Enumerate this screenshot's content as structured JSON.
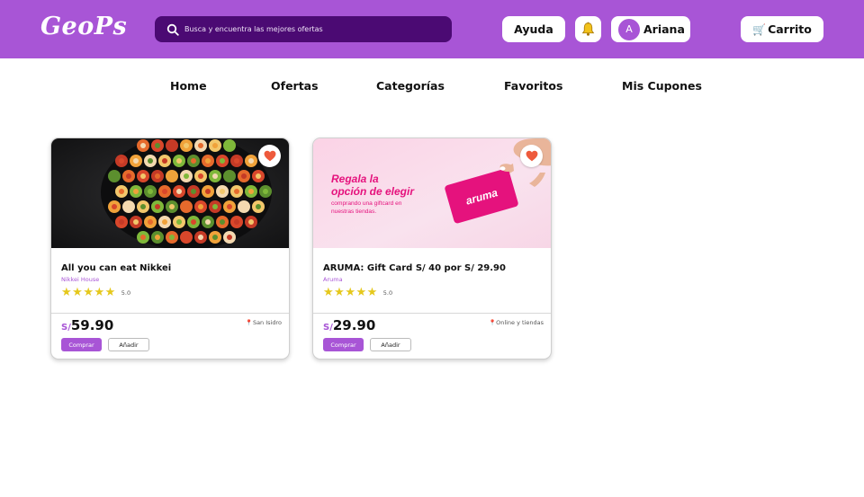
{
  "header": {
    "logo": "GeoPs",
    "search_placeholder": "Busca y encuentra las mejores ofertas",
    "help_label": "Ayuda",
    "user_initial": "A",
    "user_name": "Ariana",
    "cart_label": "Carrito"
  },
  "nav": {
    "items": [
      "Home",
      "Ofertas",
      "Categorías",
      "Favoritos",
      "Mis Cupones"
    ]
  },
  "products": [
    {
      "title": "All you can eat Nikkei",
      "store": "Nikkei House",
      "rating": "5.0",
      "stars": 5,
      "currency": "S/",
      "price": "59.90",
      "location": "San Isidro",
      "buy_label": "Comprar",
      "add_label": "Añadir"
    },
    {
      "title": "ARUMA: Gift Card S/ 40 por S/ 29.90",
      "store": "Aruma",
      "rating": "5.0",
      "stars": 5,
      "currency": "S/",
      "price": "29.90",
      "location": "Online y tiendas",
      "buy_label": "Comprar",
      "add_label": "Añadir",
      "banner": {
        "headline_1": "Regala la",
        "headline_2": "opción de elegir",
        "subtext_1": "comprando una giftcard en",
        "subtext_2": "nuestras tiendas.",
        "card_brand": "aruma"
      }
    }
  ],
  "colors": {
    "brand": "#a855d6",
    "search_bg": "#4b0a73",
    "star": "#e5c81c",
    "aruma_pink": "#e5127d"
  }
}
